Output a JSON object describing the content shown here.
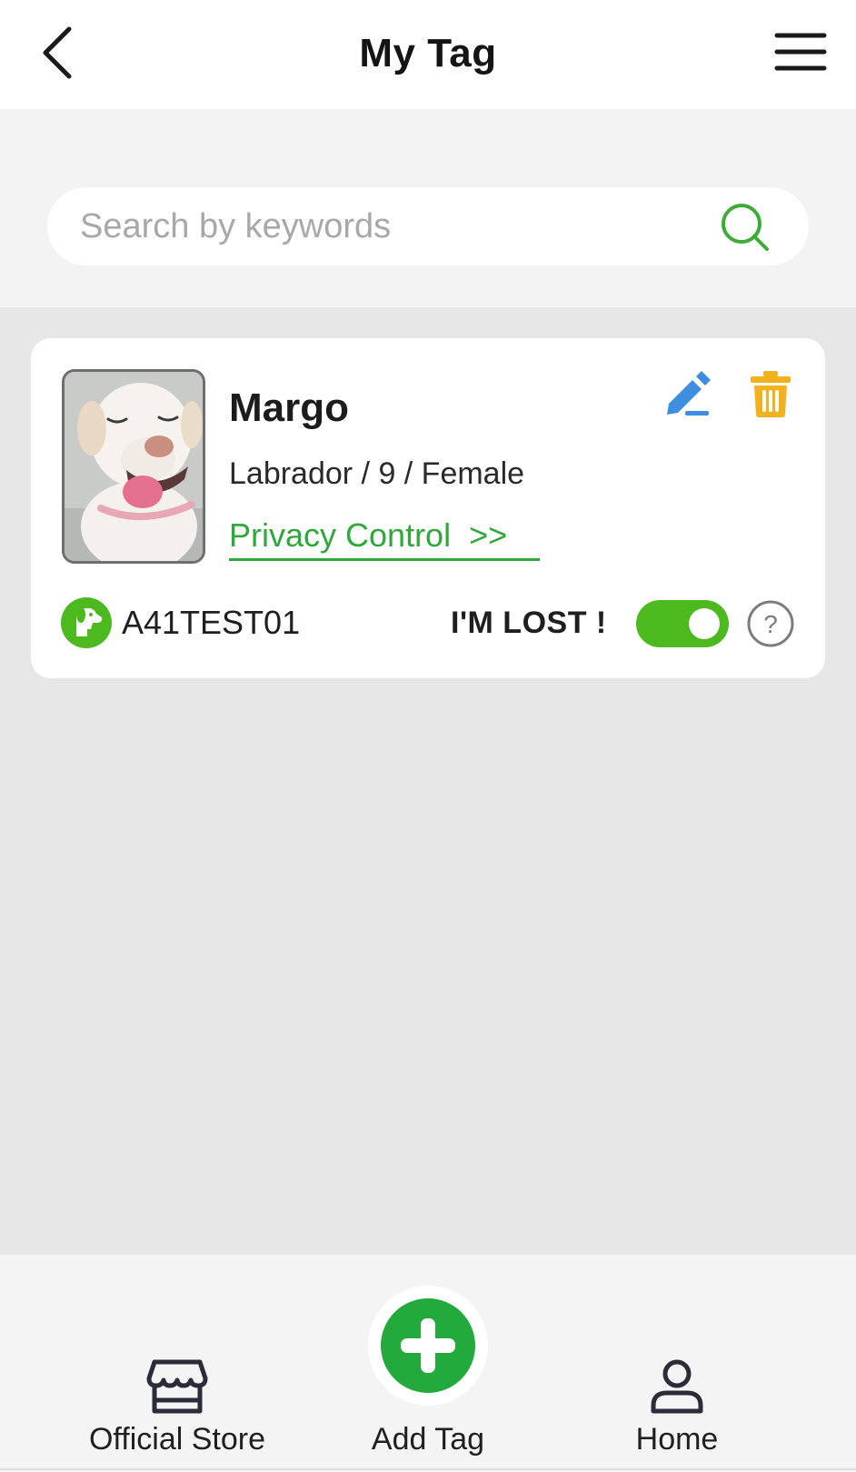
{
  "header": {
    "title": "My Tag",
    "back_icon": "chevron-left-icon",
    "menu_icon": "hamburger-menu-icon"
  },
  "search": {
    "placeholder": "Search by keywords",
    "value": "",
    "icon": "search-icon"
  },
  "pets": [
    {
      "name": "Margo",
      "info": "Labrador / 9 / Female",
      "privacy_link": "Privacy Control  >>",
      "tag_id": "A41TEST01",
      "lost_label": "I'M LOST !",
      "lost_enabled": true,
      "help_glyph": "?"
    }
  ],
  "colors": {
    "accent_green": "#2fa83a",
    "toggle_green": "#4cba1f",
    "edit_blue": "#3d8ee0",
    "delete_orange": "#f2b21d",
    "add_button_green": "#22ab3c"
  },
  "bottom_nav": {
    "store_label": "Official Store",
    "add_label": "Add Tag",
    "home_label": "Home"
  }
}
